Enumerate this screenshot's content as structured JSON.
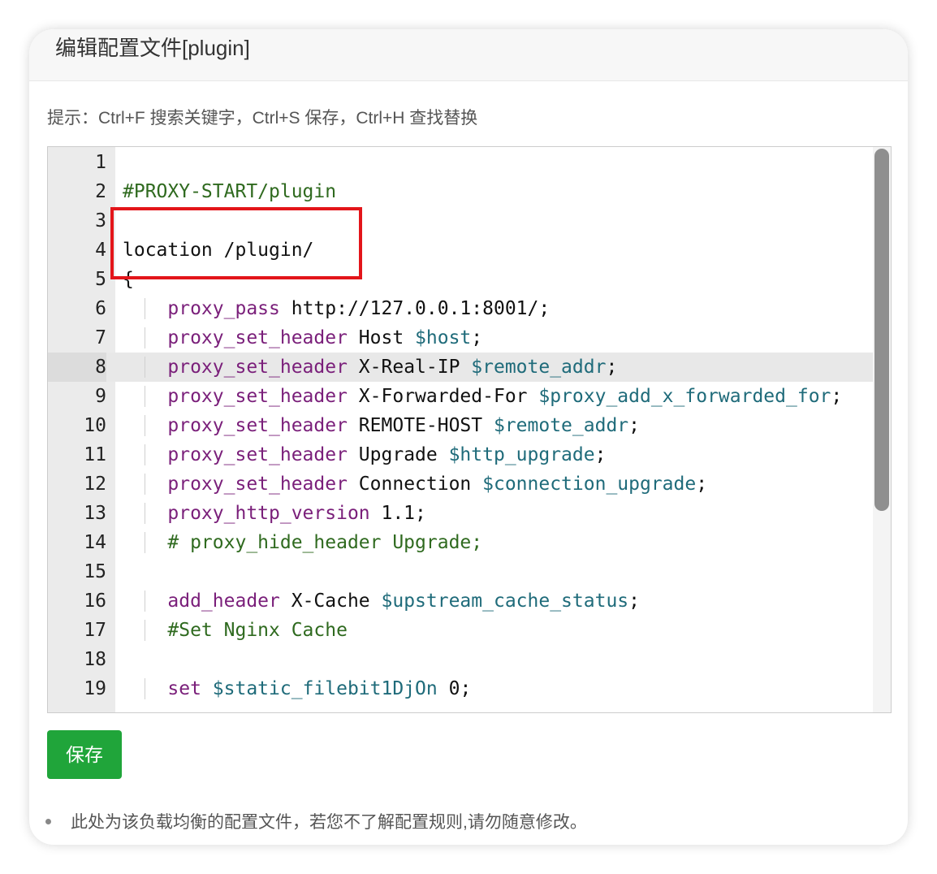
{
  "dialog": {
    "title": "编辑配置文件[plugin]",
    "hint": "提示：Ctrl+F 搜索关键字，Ctrl+S 保存，Ctrl+H 查找替换",
    "save_label": "保存",
    "note": "此处为该负载均衡的配置文件，若您不了解配置规则,请勿随意修改。"
  },
  "editor": {
    "active_line": 8,
    "lines": [
      {
        "n": "1",
        "code": ""
      },
      {
        "n": "2",
        "code": "#PROXY-START/plugin"
      },
      {
        "n": "3",
        "code": ""
      },
      {
        "n": "4",
        "code": "location /plugin/"
      },
      {
        "n": "5",
        "code": "{"
      },
      {
        "n": "6",
        "code": "    proxy_pass http://127.0.0.1:8001/;"
      },
      {
        "n": "7",
        "code": "    proxy_set_header Host $host;"
      },
      {
        "n": "8",
        "code": "    proxy_set_header X-Real-IP $remote_addr;"
      },
      {
        "n": "9",
        "code": "    proxy_set_header X-Forwarded-For $proxy_add_x_forwarded_for;"
      },
      {
        "n": "10",
        "code": "    proxy_set_header REMOTE-HOST $remote_addr;"
      },
      {
        "n": "11",
        "code": "    proxy_set_header Upgrade $http_upgrade;"
      },
      {
        "n": "12",
        "code": "    proxy_set_header Connection $connection_upgrade;"
      },
      {
        "n": "13",
        "code": "    proxy_http_version 1.1;"
      },
      {
        "n": "14",
        "code": "    # proxy_hide_header Upgrade;"
      },
      {
        "n": "15",
        "code": ""
      },
      {
        "n": "16",
        "code": "    add_header X-Cache $upstream_cache_status;"
      },
      {
        "n": "17",
        "code": "    #Set Nginx Cache"
      },
      {
        "n": "18",
        "code": ""
      },
      {
        "n": "19",
        "code": "    set $static_filebit1DjOn 0;"
      }
    ]
  },
  "colors": {
    "keyword": "#7a1f7a",
    "variable": "#1f6b7a",
    "comment": "#2f6a1f",
    "save_button": "#20a53a",
    "highlight_box": "#e3151a"
  }
}
